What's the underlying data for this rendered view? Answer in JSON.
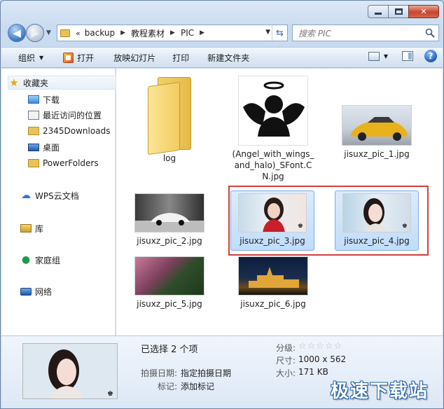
{
  "address": {
    "segments": [
      "backup",
      "教程素材",
      "PIC"
    ],
    "lead": "«"
  },
  "search": {
    "placeholder": "搜索 PIC"
  },
  "toolbar": {
    "organize": "组织",
    "open": "打开",
    "slideshow": "放映幻灯片",
    "print": "打印",
    "new_folder": "新建文件夹"
  },
  "nav": {
    "favorites": "收藏夹",
    "downloads": "下载",
    "recent": "最近访问的位置",
    "d2345": "2345Downloads",
    "desktop": "桌面",
    "powerfolders": "PowerFolders",
    "wps": "WPS云文档",
    "library": "库",
    "homegroup": "家庭组",
    "network": "网络"
  },
  "files": {
    "log": "log",
    "angel": "(Angel_with_wings_and_halo)_SFont.CN.jpg",
    "pic1": "jisuxz_pic_1.jpg",
    "pic2": "jisuxz_pic_2.jpg",
    "pic3": "jisuxz_pic_3.jpg",
    "pic4": "jisuxz_pic_4.jpg",
    "pic5": "jisuxz_pic_5.jpg",
    "pic6": "jisuxz_pic_6.jpg"
  },
  "details": {
    "selected": "已选择 2 个项",
    "rating_label": "分级:",
    "size_label": "尺寸:",
    "size_value": "1000 x 562",
    "filesize_label": "大小:",
    "filesize_value": "171 KB",
    "date_label": "拍摄日期:",
    "date_value": "指定拍摄日期",
    "tags_label": "标记:",
    "tags_value": "添加标记"
  },
  "watermark": "极速下载站",
  "colors": {
    "selection": "#c1dcfc",
    "highlight": "#d03f3f",
    "accent": "#1f5fa8"
  }
}
